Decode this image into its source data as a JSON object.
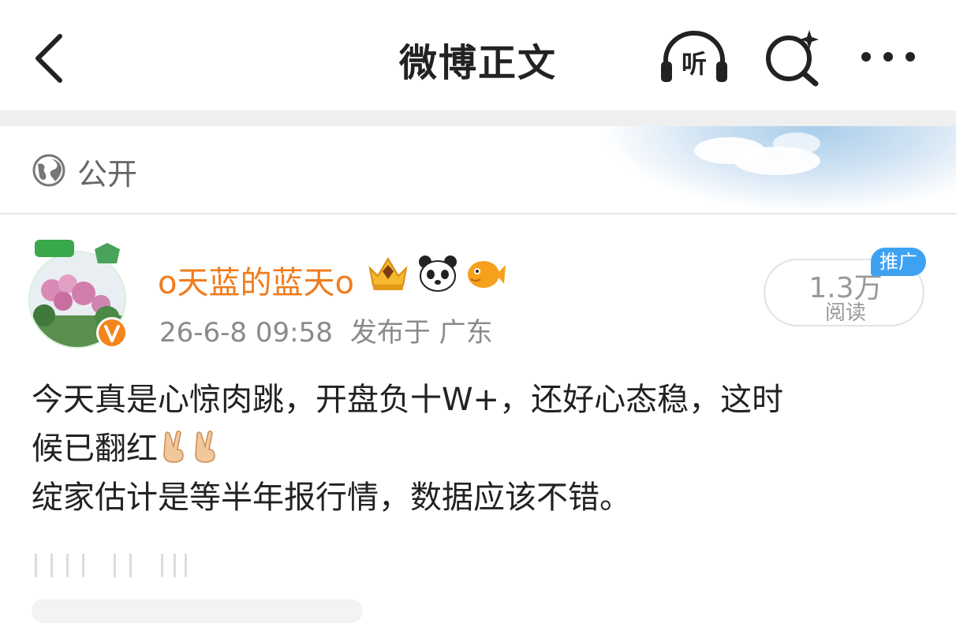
{
  "header": {
    "title": "微博正文",
    "back_icon": "chevron-left-icon",
    "listen_label": "听",
    "search_icon": "search-sparkle-icon",
    "more_icon": "more-horizontal-icon"
  },
  "visibility": {
    "icon": "globe-icon",
    "label": "公开"
  },
  "post": {
    "author": "o天蓝的蓝天o",
    "badges": [
      "crown-badge-icon",
      "panda-badge-icon",
      "fish-badge-icon"
    ],
    "verified_icon": "verified-v-icon",
    "timestamp": "26-6-8 09:58",
    "location": "发布于 广东",
    "read_count": "1.3万",
    "read_label": "阅读",
    "promo_label": "推广",
    "line1": "今天真是心惊肉跳，开盘负十W+，还好心态稳，这时",
    "line2": "候已翻红",
    "line2_emoji": [
      "victory-hand-emoji",
      "victory-hand-emoji"
    ],
    "line3": "绽家估计是等半年报行情，数据应该不错。"
  },
  "colors": {
    "username": "#f07c1c",
    "promo": "#3ea2f2",
    "meta_gray": "#8a8a8a",
    "verified": "#f3851c"
  }
}
